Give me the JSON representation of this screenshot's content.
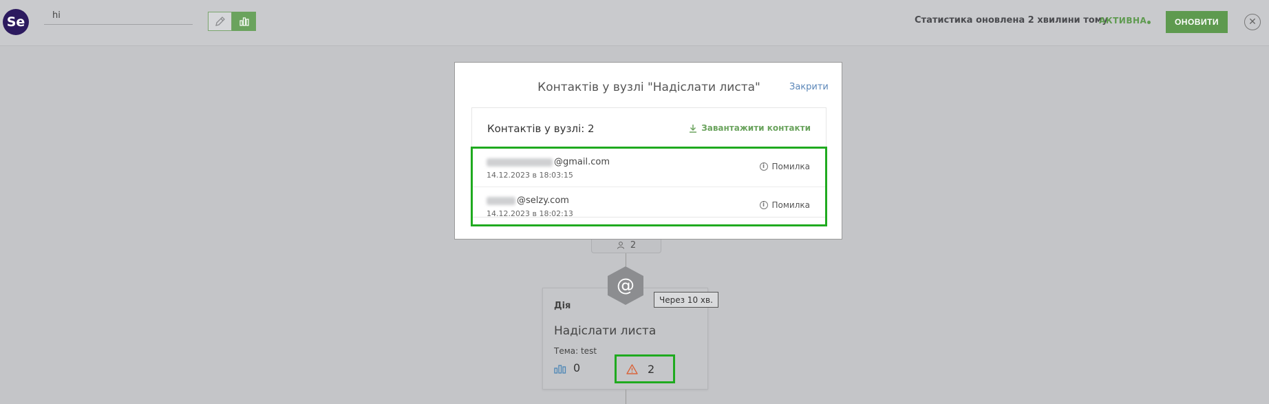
{
  "app": {
    "logo_text": "Se",
    "campaign_name": "hi"
  },
  "header": {
    "status_text": "Статистика оновлена 2 хвилини тому",
    "active_label": "АКТИВНА",
    "refresh_button": "ОНОВИТИ",
    "close_symbol": "✕",
    "accent_color": "#5e9a4f"
  },
  "modal": {
    "title": "Контактів у вузлі \"Надіслати листа\"",
    "close_link": "Закрити",
    "count_label": "Контактів у вузлі: 2",
    "download_label": "Завантажити контакти",
    "contacts": [
      {
        "email_domain": "@gmail.com",
        "date": "14.12.2023 в 18:03:15",
        "status": "Помилка"
      },
      {
        "email_domain": "@selzy.com",
        "date": "14.12.2023 в 18:02:13",
        "status": "Помилка"
      }
    ]
  },
  "flow": {
    "counter_value": "2",
    "node_icon": "@",
    "delay_label": "Через 10 хв.",
    "card": {
      "type_label": "Дія",
      "name": "Надіслати листа",
      "subject": "Тема: test",
      "stats_value": "0",
      "warning_value": "2"
    }
  }
}
